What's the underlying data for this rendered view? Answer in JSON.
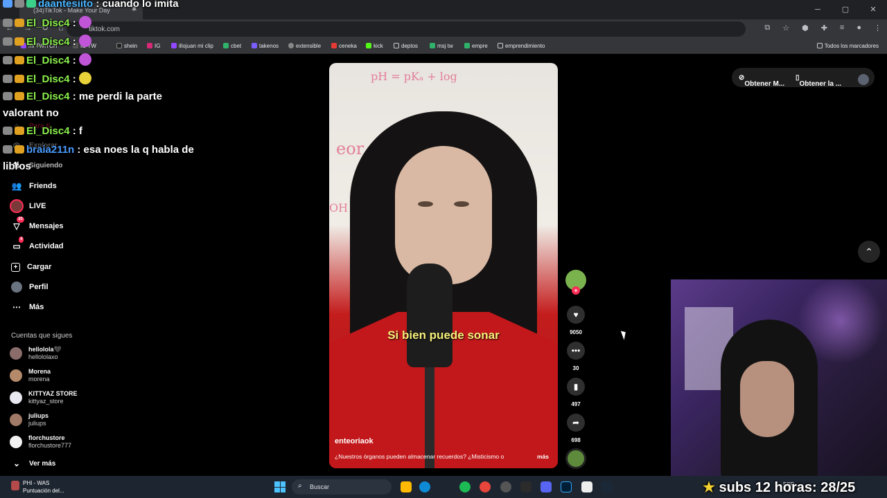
{
  "browser": {
    "tab_title": "(34)TikTok - Make Your Day",
    "url": "tiktok.com",
    "bookmarks": [
      "mi TWITCH",
      "IO TW",
      "shein",
      "IG",
      "illojuan mi clip",
      "cbet",
      "takenos",
      "extensible",
      "ceneka",
      "kick",
      "deptos",
      "msj tw",
      "empre",
      "emprendimiento"
    ],
    "all_bookmarks": "Todos los marcadores"
  },
  "sidebar": {
    "faded_items": [
      "Para ti",
      "Explorar",
      "Siguiendo"
    ],
    "items": [
      {
        "label": "Friends",
        "icon": "friends-icon"
      },
      {
        "label": "LIVE",
        "icon": "live-icon"
      },
      {
        "label": "Mensajes",
        "icon": "messages-icon",
        "badge": "30"
      },
      {
        "label": "Actividad",
        "icon": "activity-icon",
        "badge": "4"
      },
      {
        "label": "Cargar",
        "icon": "upload-icon"
      },
      {
        "label": "Perfil",
        "icon": "profile-icon"
      },
      {
        "label": "Más",
        "icon": "more-icon"
      }
    ],
    "following_title": "Cuentas que sigues",
    "accounts": [
      {
        "name": "hellolola🖤",
        "handle": "hellololaxo"
      },
      {
        "name": "Morena",
        "handle": "morena"
      },
      {
        "name": "KITTYAZ STORE",
        "handle": "kittyaz_store"
      },
      {
        "name": "juliups",
        "handle": "juliups"
      },
      {
        "name": "florchustore",
        "handle": "florchustore777"
      }
    ],
    "see_more": "Ver más"
  },
  "chat": [
    {
      "user": "daantesiito",
      "text": ": cuando lo imita"
    },
    {
      "user": "El_Disc4",
      "text": ":"
    },
    {
      "user": "El_Disc4",
      "text": ":"
    },
    {
      "user": "El_Disc4",
      "text": ":"
    },
    {
      "user": "El_Disc4",
      "text": ":"
    },
    {
      "user": "El_Disc4",
      "text": ": me perdi la parte"
    },
    {
      "user": "",
      "text": "valorant no"
    },
    {
      "user": "El_Disc4",
      "text": ": f"
    },
    {
      "user": "braia211n",
      "text": ": esa noes la q habla de"
    },
    {
      "user": "",
      "text": "libros"
    }
  ],
  "video": {
    "subtitle": "Si bien puede sonar",
    "username": "enteoriaok",
    "description": "¿Nuestros órganos pueden almacenar recuerdos? ¿Misticismo o",
    "more": "más"
  },
  "actions": {
    "likes": "9050",
    "comments": "30",
    "saves": "497",
    "shares": "698"
  },
  "top_buttons": {
    "get_1": "Obtener M...",
    "get_2": "Obtener la ..."
  },
  "overlay": {
    "subs_text": "subs 12 horas: 28/25"
  },
  "taskbar": {
    "weather_title": "PHI - WAS",
    "weather_sub": "Puntuación del...",
    "search_placeholder": "Buscar",
    "tray_lang": "ESP"
  }
}
